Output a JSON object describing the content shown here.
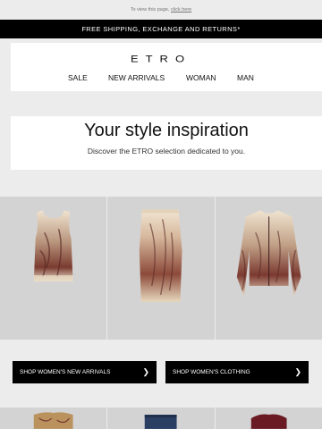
{
  "preheader": {
    "text": "To view this page, ",
    "link": "click here"
  },
  "ship_bar": {
    "text": "FREE SHIPPING, EXCHANGE AND RETURNS*"
  },
  "brand": {
    "logo": "ETRO"
  },
  "nav": [
    {
      "label": "SALE"
    },
    {
      "label": "NEW ARRIVALS"
    },
    {
      "label": "WOMAN"
    },
    {
      "label": "MAN"
    }
  ],
  "hero": {
    "title": "Your style inspiration",
    "subtitle": "Discover the ETRO selection dedicated to you."
  },
  "products": [
    {
      "icon": "paisley-sleeveless-top"
    },
    {
      "icon": "paisley-pencil-skirt"
    },
    {
      "icon": "paisley-cardigan"
    }
  ],
  "buttons": {
    "womens_new_arrivals": {
      "label": "SHOP WOMEN'S NEW ARRIVALS",
      "arrow": "❯"
    },
    "womens_clothing": {
      "label": "SHOP WOMEN'S CLOTHING",
      "arrow": "❯"
    }
  },
  "colors": {
    "accent": "#000000",
    "background": "#ececec",
    "card": "#ffffff",
    "product_bg": "#d3d3d3"
  }
}
